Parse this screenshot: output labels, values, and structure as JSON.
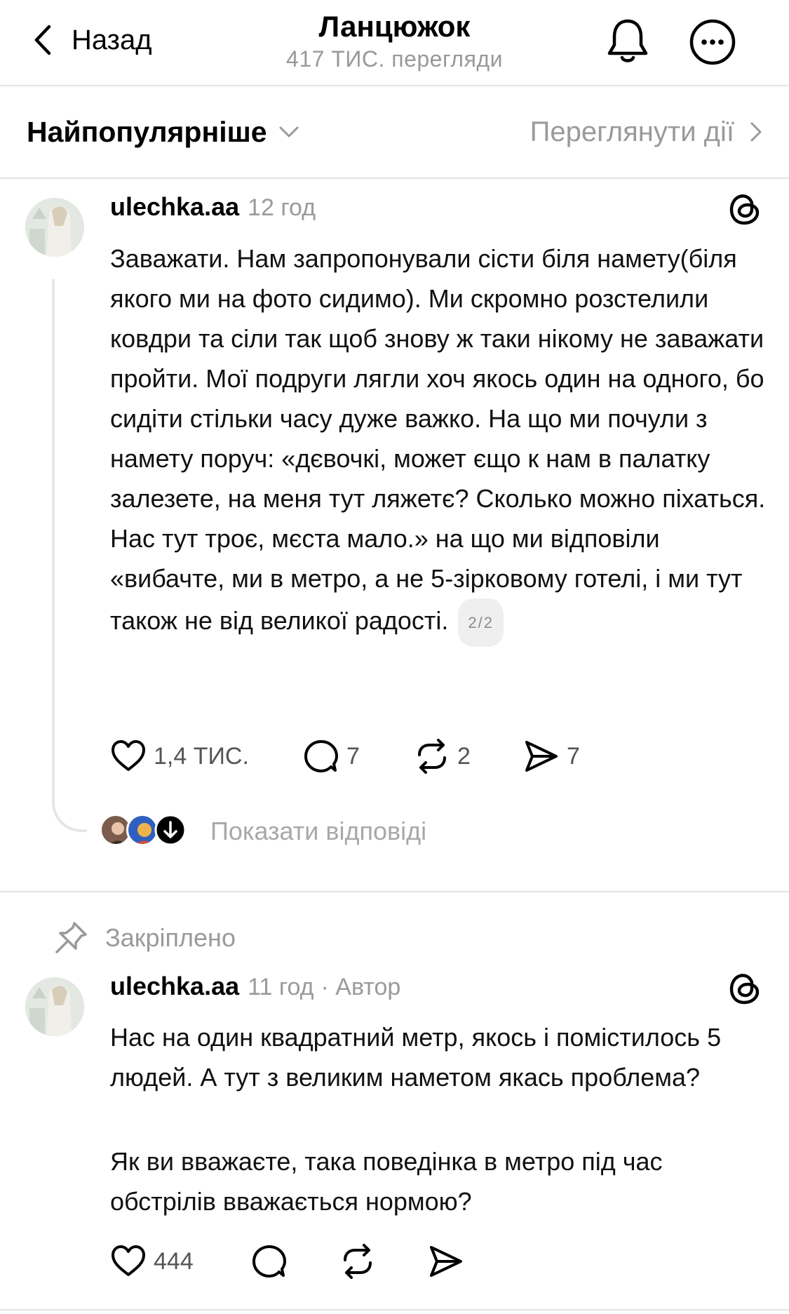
{
  "header": {
    "back_label": "Назад",
    "title": "Ланцюжок",
    "views": "417 ТИС. перегляди"
  },
  "sort_bar": {
    "sort_label": "Найпопулярніше",
    "activity_label": "Переглянути дії"
  },
  "posts": [
    {
      "username": "ulechka.aa",
      "time": "12 год",
      "text": "Заважати. Нам запропонували сісти біля намету(біля якого ми на фото сидимо). Ми скромно розстелили ковдри та сіли так щоб знову ж таки нікому не заважати пройти. Мої подруги лягли хоч якось один на одного, бо сидіти стільки часу дуже важко. На що ми почули з намету поруч: «дєвочкі, может єщо к нам в палатку залезете, на меня тут ляжетє? Сколько можно піхаться. Нас тут троє, мєста мало.» на що ми відповіли «вибачте, ми в метро, а не 5-зірковому готелі, і ми тут також не від великої радості.",
      "page_badge": "2/2",
      "likes": "1,4 ТИС.",
      "comments": "7",
      "reposts": "2",
      "shares": "7",
      "show_replies": "Показати відповіді"
    },
    {
      "pinned_label": "Закріплено",
      "username": "ulechka.aa",
      "time": "11 год",
      "author_tag": "· Автор",
      "text_1": "Нас на один квадратний метр, якось і помістилось 5 людей. А тут з великим наметом якась проблема?",
      "text_2": "Як ви вважаєте, така поведінка в метро під час обстрілів вважається нормою?",
      "likes": "444"
    }
  ],
  "icons": [
    "chevron-left-icon",
    "bell-icon",
    "more-icon",
    "chevron-down-icon",
    "chevron-right-icon",
    "threads-icon",
    "heart-icon",
    "comment-icon",
    "repost-icon",
    "share-icon",
    "arrow-down-icon",
    "pin-icon"
  ],
  "colors": {
    "text": "#000000",
    "muted": "#9a9a9a",
    "divider": "#e4e4e4"
  }
}
